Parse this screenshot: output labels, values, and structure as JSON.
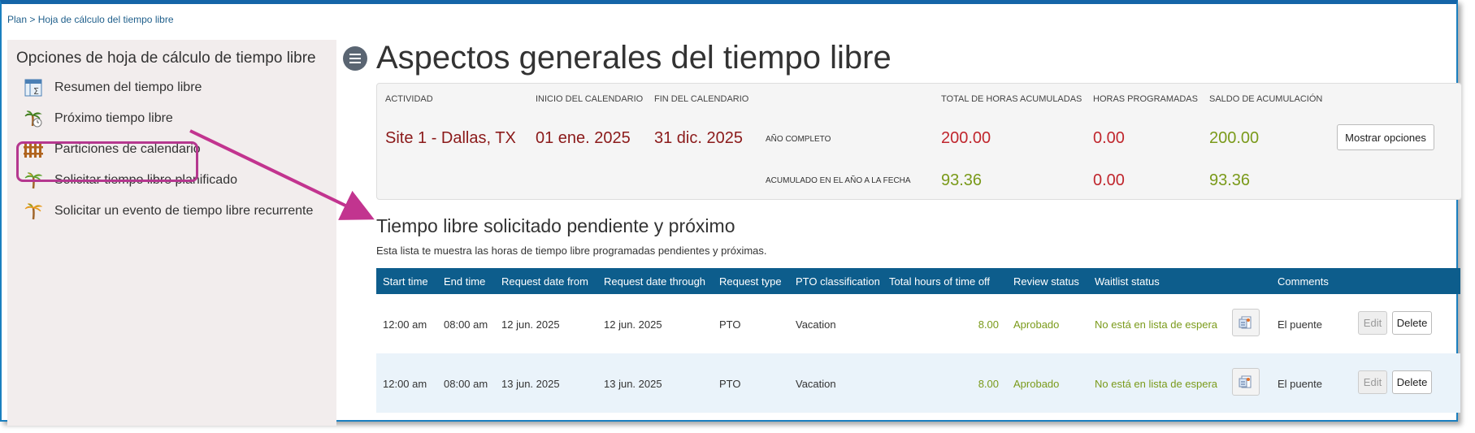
{
  "breadcrumb": {
    "root": "Plan",
    "separator": ">",
    "current": "Hoja de cálculo del tiempo libre"
  },
  "sidebar": {
    "title": "Opciones de hoja de cálculo de tiempo libre",
    "items": [
      {
        "label": "Resumen del tiempo libre",
        "icon": "summary-sheet-icon"
      },
      {
        "label": "Próximo tiempo libre",
        "icon": "palm-tree-clock-icon"
      },
      {
        "label": "Particiones de calendario",
        "icon": "fence-icon"
      },
      {
        "label": "Solicitar tiempo libre planificado",
        "icon": "palm-tree-icon"
      },
      {
        "label": "Solicitar un evento de tiempo libre recurrente",
        "icon": "palm-tree-icon"
      }
    ]
  },
  "main": {
    "title": "Aspectos generales del tiempo libre",
    "summary": {
      "headers": {
        "activity": "ACTIVIDAD",
        "start": "INICIO DEL CALENDARIO",
        "end": "FIN DEL CALENDARIO",
        "accrued": "TOTAL DE HORAS ACUMULADAS",
        "scheduled": "HORAS PROGRAMADAS",
        "balance": "SALDO DE ACUMULACIÓN"
      },
      "activity": "Site 1 - Dallas, TX",
      "start": "01 ene. 2025",
      "end": "31 dic. 2025",
      "rows": [
        {
          "label": "AÑO COMPLETO",
          "accrued": "200.00",
          "scheduled": "0.00",
          "balance": "200.00"
        },
        {
          "label": "ACUMULADO EN EL AÑO A LA FECHA",
          "accrued": "93.36",
          "scheduled": "0.00",
          "balance": "93.36"
        }
      ],
      "show_options": "Mostrar opciones"
    },
    "section_title": "Tiempo libre solicitado pendiente y próximo",
    "section_subtitle": "Esta lista te muestra las horas de tiempo libre programadas pendientes y próximas.",
    "table": {
      "columns": [
        "Start time",
        "End time",
        "Request date from",
        "Request date through",
        "Request type",
        "PTO classification",
        "Total hours of time off",
        "Review status",
        "Waitlist status",
        "Comments"
      ],
      "rows": [
        {
          "start": "12:00 am",
          "end": "08:00 am",
          "from": "12 jun. 2025",
          "through": "12 jun. 2025",
          "type": "PTO",
          "classification": "Vacation",
          "hours": "8.00",
          "review": "Aprobado",
          "waitlist": "No está en lista de espera",
          "comments": "El puente",
          "edit": "Edit",
          "delete": "Delete"
        },
        {
          "start": "12:00 am",
          "end": "08:00 am",
          "from": "13 jun. 2025",
          "through": "13 jun. 2025",
          "type": "PTO",
          "classification": "Vacation",
          "hours": "8.00",
          "review": "Aprobado",
          "waitlist": "No está en lista de espera",
          "comments": "El puente",
          "edit": "Edit",
          "delete": "Delete"
        }
      ]
    }
  },
  "colors": {
    "accent_header": "#0d5d8c",
    "highlight": "#b5388f",
    "value_red": "#c0262d",
    "value_green": "#7a9a1a",
    "activity_red": "#8b1a1a"
  }
}
